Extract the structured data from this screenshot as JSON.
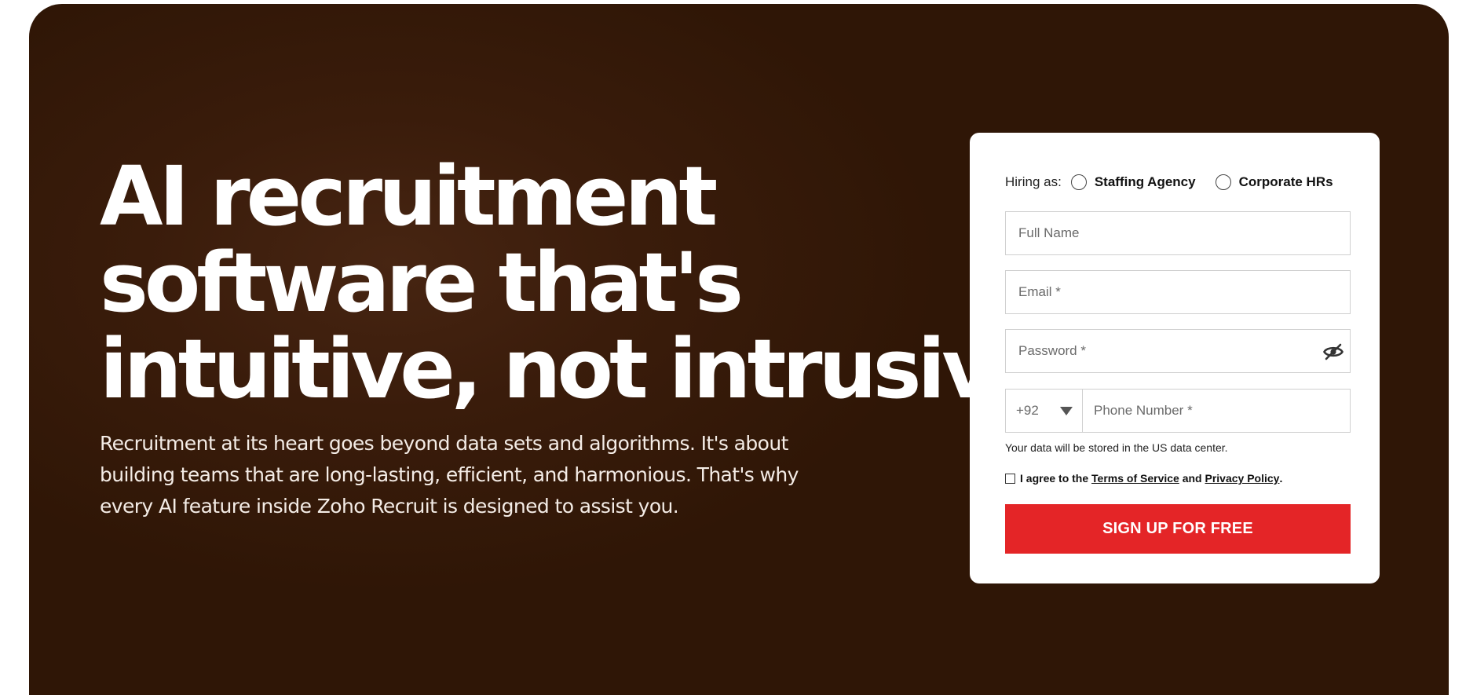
{
  "hero": {
    "headline_lines": [
      "AI recruitment",
      "software that's",
      "intuitive, not intrusive"
    ],
    "subtext_lines": [
      "Recruitment at its heart goes beyond data sets and algorithms. It's about",
      "building teams that are long-lasting, efficient, and harmonious. That's why",
      "every AI feature inside Zoho Recruit is designed to assist you."
    ]
  },
  "signup_form": {
    "hiring_label": "Hiring as:",
    "hiring_options": [
      "Staffing Agency",
      "Corporate HRs"
    ],
    "full_name_placeholder": "Full Name",
    "email_placeholder": "Email *",
    "password_placeholder": "Password *",
    "country_code": "+92",
    "phone_placeholder": "Phone Number *",
    "data_center_note": "Your data will be stored in the US data center.",
    "agree_prefix": "I agree to the ",
    "terms_link": "Terms of Service",
    "agree_and": " and ",
    "privacy_link": "Privacy Policy",
    "agree_suffix": ".",
    "submit_label": "SIGN UP FOR FREE"
  },
  "icons": {
    "password_toggle": "eye-slash-icon",
    "country_dropdown": "caret-down-icon"
  },
  "colors": {
    "hero_background": "#2f1606",
    "cta_background": "#e42527",
    "card_background": "#ffffff"
  }
}
